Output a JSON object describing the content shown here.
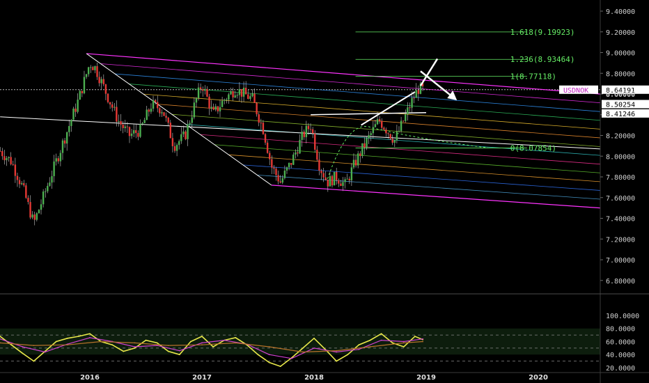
{
  "theme": {
    "background": "#000000",
    "up": "#4caf50",
    "down": "#e53935",
    "fib_color": "#66ee66",
    "pitchfork_color": "#ff33ff",
    "axis_text": "#d0d0d0"
  },
  "chart_data": [
    {
      "type": "candlestick",
      "instrument": "USDNOK",
      "x_labels": [
        "2016",
        "2017",
        "2018",
        "2019",
        "2020"
      ],
      "y_ticks": [
        "9.40000",
        "9.20000",
        "9.00000",
        "8.80000",
        "8.60000",
        "8.40000",
        "8.20000",
        "8.00000",
        "7.80000",
        "7.60000",
        "7.40000",
        "7.20000",
        "7.00000",
        "6.80000"
      ],
      "ylim": [
        6.72,
        9.5
      ],
      "xlim": [
        2015.2,
        2020.6
      ],
      "grid": false,
      "price_tags": [
        {
          "label": "USDNOK",
          "value": "8.64191",
          "style": "instrument"
        },
        {
          "value": "8.60000",
          "style": "faded"
        },
        {
          "value": "8.50254",
          "style": "white"
        },
        {
          "value": "8.41246",
          "style": "white"
        }
      ],
      "fib_levels": [
        {
          "label": "1.618(9.19923)",
          "value": 9.19923
        },
        {
          "label": "1.236(8.93464)",
          "value": 8.93464
        },
        {
          "label": "1(8.77118)",
          "value": 8.77118
        },
        {
          "label": "0(8.07854)",
          "value": 8.07854
        }
      ],
      "price_path": [
        [
          2015.2,
          8.05
        ],
        [
          2015.3,
          7.95
        ],
        [
          2015.4,
          7.7
        ],
        [
          2015.5,
          7.35
        ],
        [
          2015.6,
          7.65
        ],
        [
          2015.7,
          7.95
        ],
        [
          2015.8,
          8.25
        ],
        [
          2015.9,
          8.55
        ],
        [
          2016.0,
          8.9
        ],
        [
          2016.05,
          8.85
        ],
        [
          2016.15,
          8.6
        ],
        [
          2016.25,
          8.35
        ],
        [
          2016.35,
          8.2
        ],
        [
          2016.45,
          8.25
        ],
        [
          2016.55,
          8.5
        ],
        [
          2016.65,
          8.45
        ],
        [
          2016.75,
          8.1
        ],
        [
          2016.85,
          8.2
        ],
        [
          2016.95,
          8.55
        ],
        [
          2017.0,
          8.7
        ],
        [
          2017.1,
          8.4
        ],
        [
          2017.2,
          8.55
        ],
        [
          2017.3,
          8.65
        ],
        [
          2017.45,
          8.55
        ],
        [
          2017.55,
          8.25
        ],
        [
          2017.62,
          7.9
        ],
        [
          2017.7,
          7.75
        ],
        [
          2017.8,
          7.95
        ],
        [
          2017.9,
          8.2
        ],
        [
          2017.97,
          8.3
        ],
        [
          2018.05,
          7.9
        ],
        [
          2018.12,
          7.75
        ],
        [
          2018.2,
          7.8
        ],
        [
          2018.28,
          7.72
        ],
        [
          2018.35,
          7.9
        ],
        [
          2018.42,
          8.05
        ],
        [
          2018.5,
          8.2
        ],
        [
          2018.58,
          8.35
        ],
        [
          2018.65,
          8.25
        ],
        [
          2018.72,
          8.15
        ],
        [
          2018.8,
          8.35
        ],
        [
          2018.88,
          8.55
        ],
        [
          2018.93,
          8.65
        ],
        [
          2018.97,
          8.64
        ]
      ],
      "lines": {
        "pitchfork_upper": [
          [
            2015.97,
            8.99
          ],
          [
            2020.55,
            8.6
          ]
        ],
        "pitchfork_lower": [
          [
            2017.62,
            7.72
          ],
          [
            2020.55,
            7.5
          ]
        ],
        "trendline_down": [
          [
            2015.97,
            8.99
          ],
          [
            2017.62,
            7.72
          ]
        ],
        "trendline_white": [
          [
            2015.2,
            8.38
          ],
          [
            2020.55,
            8.07
          ]
        ],
        "breakout_line": [
          [
            2017.97,
            8.4
          ],
          [
            2019.0,
            8.42
          ]
        ],
        "rising_wedge": [
          [
            2018.42,
            8.3
          ],
          [
            2018.9,
            8.62
          ]
        ],
        "arrow_up": [
          [
            2018.95,
            8.68
          ],
          [
            2019.1,
            8.94
          ]
        ],
        "arrow_down": [
          [
            2018.95,
            8.82
          ],
          [
            2019.25,
            8.56
          ]
        ]
      }
    },
    {
      "type": "line",
      "title": "",
      "y_ticks": [
        "100.0000",
        "80.0000",
        "60.0000",
        "40.0000",
        "20.0000"
      ],
      "ylim": [
        12,
        105
      ],
      "xlim": [
        2015.2,
        2020.6
      ],
      "reference_lines": [
        70,
        50,
        30
      ],
      "series": [
        {
          "color": "#e8e84a",
          "x": [
            2015.2,
            2015.3,
            2015.4,
            2015.5,
            2015.6,
            2015.7,
            2015.8,
            2015.9,
            2016.0,
            2016.1,
            2016.2,
            2016.3,
            2016.4,
            2016.5,
            2016.6,
            2016.7,
            2016.8,
            2016.9,
            2017.0,
            2017.1,
            2017.2,
            2017.3,
            2017.4,
            2017.5,
            2017.6,
            2017.7,
            2017.8,
            2017.9,
            2018.0,
            2018.1,
            2018.2,
            2018.3,
            2018.4,
            2018.5,
            2018.6,
            2018.7,
            2018.8,
            2018.9,
            2018.97
          ],
          "values": [
            68,
            55,
            42,
            30,
            45,
            60,
            65,
            68,
            72,
            60,
            55,
            45,
            50,
            62,
            58,
            45,
            40,
            60,
            68,
            52,
            62,
            66,
            55,
            40,
            28,
            22,
            35,
            50,
            65,
            48,
            30,
            40,
            55,
            62,
            72,
            58,
            52,
            68,
            63
          ]
        },
        {
          "color": "#d040d0",
          "x": [
            2015.2,
            2015.4,
            2015.6,
            2015.8,
            2016.0,
            2016.2,
            2016.4,
            2016.6,
            2016.8,
            2017.0,
            2017.2,
            2017.4,
            2017.6,
            2017.8,
            2018.0,
            2018.2,
            2018.4,
            2018.6,
            2018.8,
            2018.97
          ],
          "values": [
            64,
            52,
            44,
            56,
            66,
            60,
            52,
            54,
            46,
            58,
            62,
            56,
            40,
            34,
            50,
            44,
            48,
            62,
            60,
            64
          ]
        },
        {
          "color": "#b8732a",
          "x": [
            2015.2,
            2015.5,
            2015.8,
            2016.1,
            2016.4,
            2016.7,
            2017.0,
            2017.3,
            2017.6,
            2017.9,
            2018.2,
            2018.5,
            2018.8,
            2018.97
          ],
          "values": [
            58,
            54,
            55,
            60,
            58,
            54,
            55,
            58,
            52,
            44,
            46,
            52,
            58,
            60
          ]
        }
      ]
    }
  ]
}
